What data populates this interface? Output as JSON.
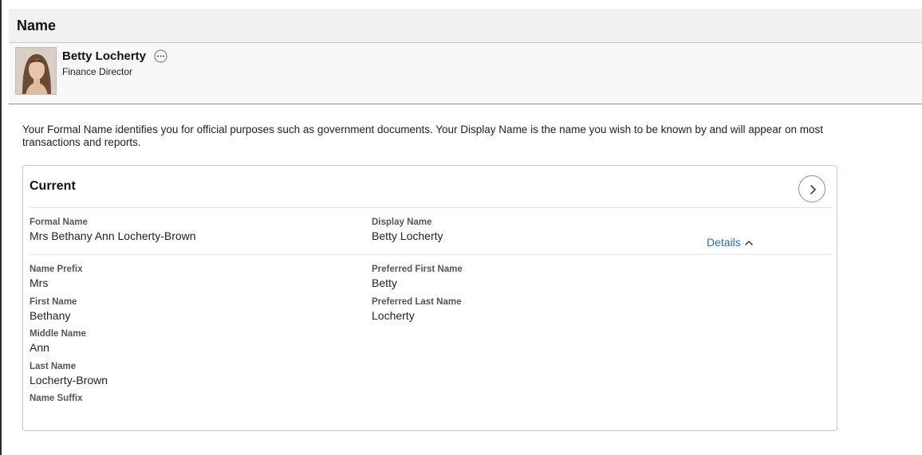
{
  "header": {
    "title": "Name"
  },
  "person": {
    "name": "Betty Locherty",
    "job_title": "Finance Director"
  },
  "intro_text": "Your Formal Name identifies you for official purposes such as government documents. Your Display Name is the name you wish to be known by and will appear on most transactions and reports.",
  "current_card": {
    "title": "Current",
    "formal_name": {
      "label": "Formal Name",
      "value": "Mrs Bethany Ann Locherty-Brown"
    },
    "display_name": {
      "label": "Display Name",
      "value": "Betty Locherty"
    },
    "details_label": "Details",
    "name_prefix": {
      "label": "Name Prefix",
      "value": "Mrs"
    },
    "first_name": {
      "label": "First Name",
      "value": "Bethany"
    },
    "middle_name": {
      "label": "Middle Name",
      "value": "Ann"
    },
    "last_name": {
      "label": "Last Name",
      "value": "Locherty-Brown"
    },
    "name_suffix": {
      "label": "Name Suffix",
      "value": ""
    },
    "preferred_first_name": {
      "label": "Preferred First Name",
      "value": "Betty"
    },
    "preferred_last_name": {
      "label": "Preferred Last Name",
      "value": "Locherty"
    }
  },
  "icons": {
    "related_actions": "ellipsis-circle-icon",
    "nav": "chevron-right-icon",
    "details_toggle": "chevron-up-icon"
  },
  "colors": {
    "link": "#2a6fa8",
    "header_bg": "#f1f1f1"
  }
}
